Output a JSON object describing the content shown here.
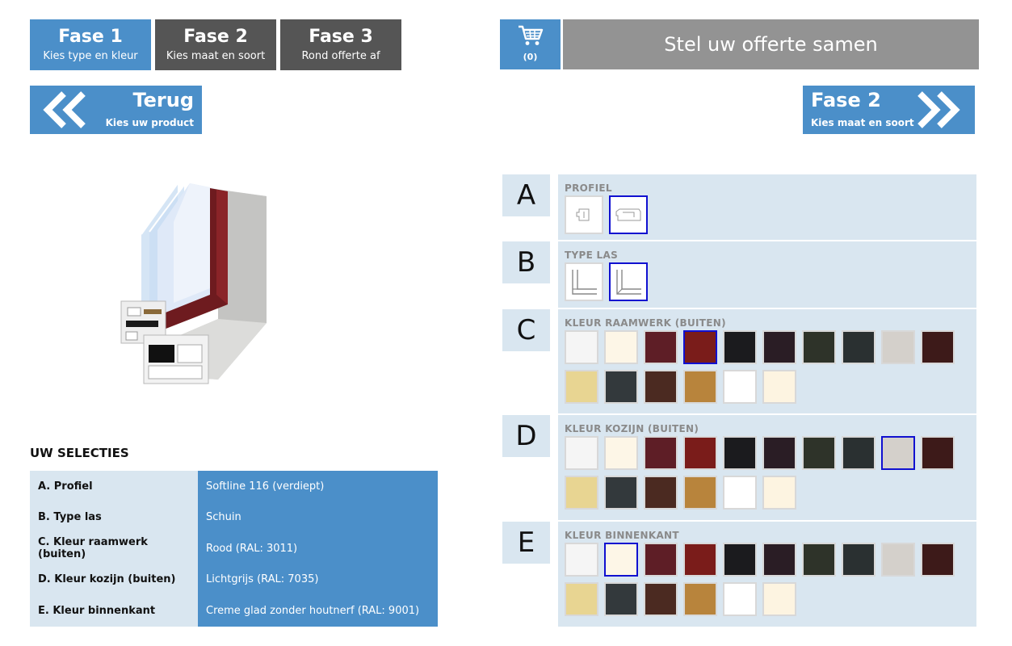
{
  "phases": [
    {
      "title": "Fase 1",
      "subtitle": "Kies type en kleur",
      "state": "active"
    },
    {
      "title": "Fase 2",
      "subtitle": "Kies maat en soort",
      "state": "inactive"
    },
    {
      "title": "Fase 3",
      "subtitle": "Rond offerte af",
      "state": "inactive"
    }
  ],
  "cart": {
    "count": "(0)",
    "icon": "cart-icon"
  },
  "offerte_label": "Stel uw offerte samen",
  "back": {
    "title": "Terug",
    "subtitle": "Kies uw product",
    "icon": "double-chevron-left-icon"
  },
  "next": {
    "title": "Fase 2",
    "subtitle": "Kies maat en soort",
    "icon": "double-chevron-right-icon"
  },
  "selections": {
    "heading": "UW SELECTIES",
    "rows": [
      {
        "key": "A. Profiel",
        "value": "Softline 116 (verdiept)"
      },
      {
        "key": "B. Type las",
        "value": "Schuin"
      },
      {
        "key": "C. Kleur raamwerk (buiten)",
        "value": "Rood (RAL: 3011)"
      },
      {
        "key": "D. Kleur kozijn (buiten)",
        "value": "Lichtgrijs (RAL: 7035)"
      },
      {
        "key": "E. Kleur binnenkant",
        "value": "Creme glad zonder houtnerf (RAL: 9001)"
      }
    ]
  },
  "colors": [
    "#f5f5f5",
    "#fdf6e7",
    "#5e1e26",
    "#7a1c1a",
    "#1b1b1e",
    "#2a1d25",
    "#2e3329",
    "#2a3031",
    "#d4d0cb",
    "#3d1a19",
    "#e8d592",
    "#33393c",
    "#4b2a21",
    "#b8843c",
    "#ffffff",
    "#fdf4e1"
  ],
  "options": [
    {
      "letter": "A",
      "label": "PROFIEL",
      "kind": "shape",
      "icon": "profile-icon",
      "selected": 1
    },
    {
      "letter": "B",
      "label": "TYPE LAS",
      "kind": "shape",
      "icon": "corner-weld-icon",
      "selected": 1
    },
    {
      "letter": "C",
      "label": "KLEUR RAAMWERK (BUITEN)",
      "kind": "color",
      "selected": 3
    },
    {
      "letter": "D",
      "label": "KLEUR KOZIJN (BUITEN)",
      "kind": "color",
      "selected": 8
    },
    {
      "letter": "E",
      "label": "KLEUR BINNENKANT",
      "kind": "color",
      "selected": 1
    }
  ]
}
